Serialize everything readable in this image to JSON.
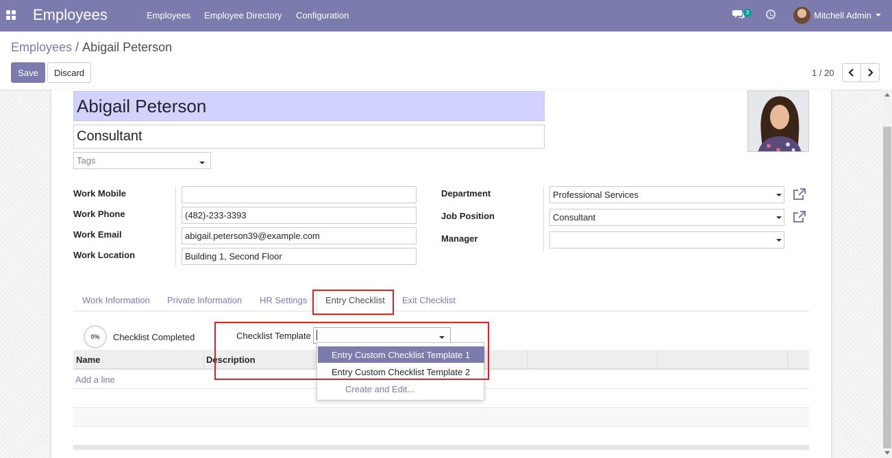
{
  "navbar": {
    "app_title": "Employees",
    "menus": [
      "Employees",
      "Employee Directory",
      "Configuration"
    ],
    "chat_badge": "3",
    "user_name": "Mitchell Admin"
  },
  "breadcrumb": {
    "parent": "Employees",
    "current": "Abigail Peterson"
  },
  "actions": {
    "save": "Save",
    "discard": "Discard"
  },
  "pager": {
    "value": "1 / 20"
  },
  "employee": {
    "name": "Abigail Peterson",
    "job_title": "Consultant",
    "tags_placeholder": "Tags"
  },
  "fields_left": [
    {
      "label": "Work Mobile",
      "value": ""
    },
    {
      "label": "Work Phone",
      "value": "(482)-233-3393"
    },
    {
      "label": "Work Email",
      "value": "abigail.peterson39@example.com"
    },
    {
      "label": "Work Location",
      "value": "Building 1, Second Floor"
    }
  ],
  "fields_right": [
    {
      "label": "Department",
      "value": "Professional Services"
    },
    {
      "label": "Job Position",
      "value": "Consultant"
    },
    {
      "label": "Manager",
      "value": ""
    }
  ],
  "tabs": [
    {
      "label": "Work Information"
    },
    {
      "label": "Private Information"
    },
    {
      "label": "HR Settings"
    },
    {
      "label": "Entry Checklist"
    },
    {
      "label": "Exit Checklist"
    }
  ],
  "checklist": {
    "progress": "0%",
    "completed_label": "Checklist Completed",
    "template_label": "Checklist Template",
    "template_value": ""
  },
  "table": {
    "columns": [
      "Name",
      "Description"
    ],
    "add_line": "Add a line"
  },
  "dropdown": {
    "options": [
      "Entry Custom Checklist Template 1",
      "Entry Custom Checklist Template 2"
    ],
    "create_edit": "Create and Edit..."
  },
  "colors": {
    "brand": "#7c7bad",
    "name_bg": "#d2d2ff",
    "highlight": "#e02020"
  }
}
